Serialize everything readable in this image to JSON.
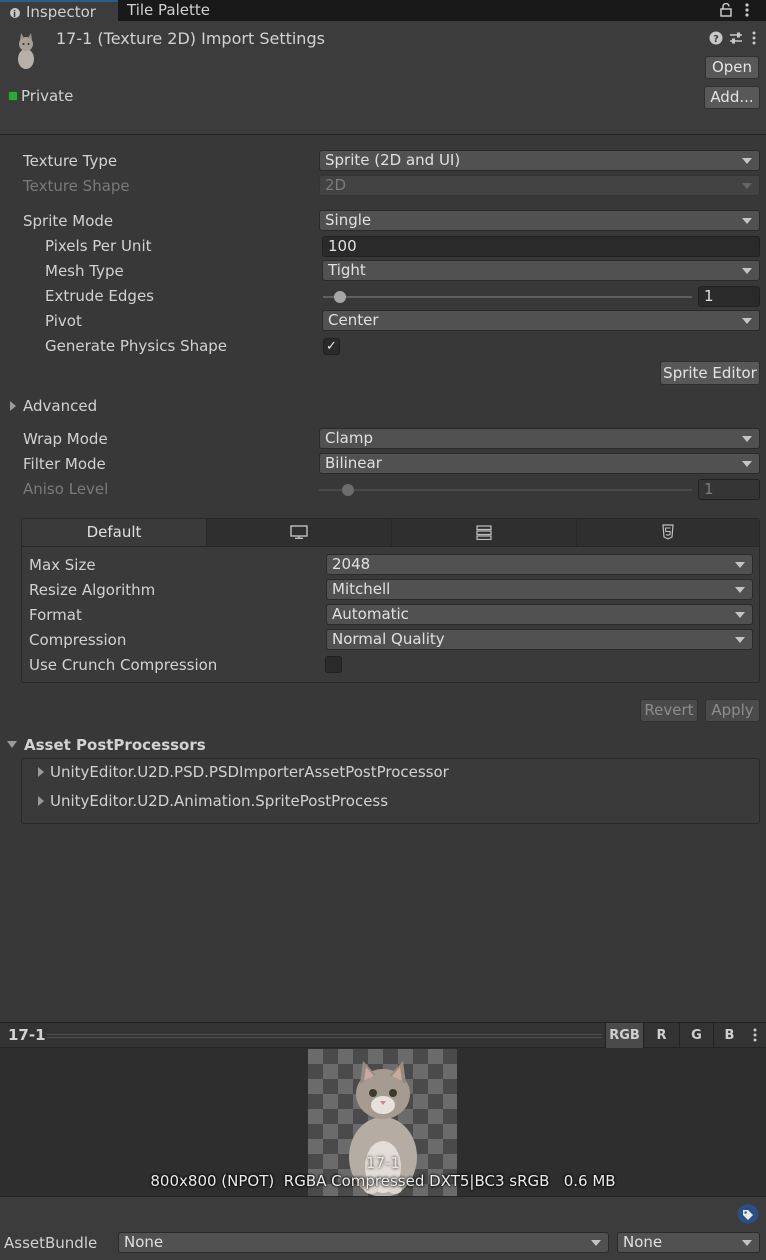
{
  "tabs": {
    "inspector": "Inspector",
    "tile_palette": "Tile Palette"
  },
  "header": {
    "title": "17-1 (Texture 2D) Import Settings",
    "open_label": "Open",
    "add_label": "Add...",
    "private_label": "Private"
  },
  "settings": {
    "texture_type_label": "Texture Type",
    "texture_type_value": "Sprite (2D and UI)",
    "texture_shape_label": "Texture Shape",
    "texture_shape_value": "2D",
    "sprite_mode_label": "Sprite Mode",
    "sprite_mode_value": "Single",
    "ppu_label": "Pixels Per Unit",
    "ppu_value": "100",
    "mesh_type_label": "Mesh Type",
    "mesh_type_value": "Tight",
    "extrude_label": "Extrude Edges",
    "extrude_value": "1",
    "pivot_label": "Pivot",
    "pivot_value": "Center",
    "physics_label": "Generate Physics Shape",
    "physics_checked": true,
    "sprite_editor_label": "Sprite Editor",
    "advanced_label": "Advanced",
    "wrap_label": "Wrap Mode",
    "wrap_value": "Clamp",
    "filter_label": "Filter Mode",
    "filter_value": "Bilinear",
    "aniso_label": "Aniso Level",
    "aniso_value": "1"
  },
  "platform": {
    "default_tab": "Default",
    "max_size_label": "Max Size",
    "max_size_value": "2048",
    "resize_label": "Resize Algorithm",
    "resize_value": "Mitchell",
    "format_label": "Format",
    "format_value": "Automatic",
    "compression_label": "Compression",
    "compression_value": "Normal Quality",
    "crunch_label": "Use Crunch Compression",
    "crunch_checked": false
  },
  "actions": {
    "revert": "Revert",
    "apply": "Apply"
  },
  "postprocessors": {
    "title": "Asset PostProcessors",
    "items": [
      "UnityEditor.U2D.PSD.PSDImporterAssetPostProcessor",
      "UnityEditor.U2D.Animation.SpritePostProcess"
    ]
  },
  "preview": {
    "name": "17-1",
    "channels": [
      "RGB",
      "R",
      "G",
      "B"
    ],
    "selected_channel": "RGB",
    "overlay_label": "17-1",
    "info": "800x800 (NPOT)  RGBA Compressed DXT5|BC3 sRGB   0.6 MB"
  },
  "asset_bundle": {
    "label": "AssetBundle",
    "name_value": "None",
    "variant_value": "None"
  },
  "colors": {
    "accent": "#2c5d87",
    "checker_light": "#6b6b6b",
    "checker_dark": "#4a4a4a",
    "private_check": "#2fa83a"
  }
}
